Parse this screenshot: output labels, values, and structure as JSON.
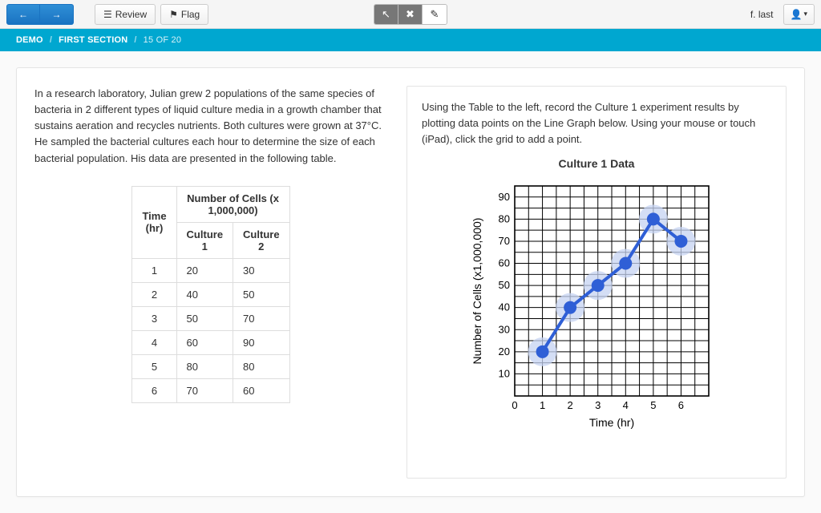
{
  "toolbar": {
    "review_label": "Review",
    "flag_label": "Flag"
  },
  "user": {
    "name": "f. last"
  },
  "breadcrumb": {
    "a": "DEMO",
    "b": "FIRST SECTION",
    "c": "15 OF 20"
  },
  "left": {
    "intro": "In a research laboratory, Julian grew 2 populations of the same species of bacteria in 2 different types of liquid culture media in a growth chamber that sustains aeration and recycles nutrients. Both cultures were grown at 37°C. He sampled the bacterial cultures each hour to determine the size of each bacterial population. His data are presented in the following table.",
    "table": {
      "time_header": "Time (hr)",
      "num_header": "Number of Cells (x 1,000,000)",
      "c1_header": "Culture 1",
      "c2_header": "Culture 2",
      "rows": [
        {
          "t": "1",
          "c1": "20",
          "c2": "30"
        },
        {
          "t": "2",
          "c1": "40",
          "c2": "50"
        },
        {
          "t": "3",
          "c1": "50",
          "c2": "70"
        },
        {
          "t": "4",
          "c1": "60",
          "c2": "90"
        },
        {
          "t": "5",
          "c1": "80",
          "c2": "80"
        },
        {
          "t": "6",
          "c1": "70",
          "c2": "60"
        }
      ]
    }
  },
  "right": {
    "intro": "Using the Table to the left, record the Culture 1 experiment results by plotting data points on the Line Graph below. Using your mouse or touch (iPad), click the grid to add a point.",
    "chart_title": "Culture 1 Data"
  },
  "chart_data": {
    "type": "line",
    "title": "Culture 1 Data",
    "xlabel": "Time (hr)",
    "ylabel": "Number of Cells (x1,000,000)",
    "xlim": [
      0,
      7
    ],
    "ylim": [
      0,
      95
    ],
    "x_ticks": [
      0,
      1,
      2,
      3,
      4,
      5,
      6
    ],
    "y_ticks": [
      10,
      20,
      30,
      40,
      50,
      60,
      70,
      80,
      90
    ],
    "series": [
      {
        "name": "Culture 1",
        "x": [
          1,
          2,
          3,
          4,
          5,
          6
        ],
        "y": [
          20,
          40,
          50,
          60,
          80,
          70
        ]
      }
    ],
    "colors": {
      "line": "#2f5fd6",
      "point": "#2f5fd6",
      "halo": "#c6d3f2",
      "axis": "#000",
      "grid": "#000"
    }
  }
}
